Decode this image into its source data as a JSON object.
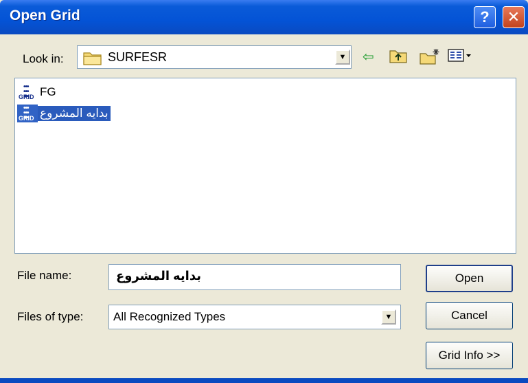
{
  "window": {
    "title": "Open Grid",
    "help_label": "?",
    "close_label": "✕",
    "colors": {
      "titlebar": "#0453d6",
      "selection": "#2a5bbc",
      "face": "#ece9d8"
    }
  },
  "look_in": {
    "label": "Look in:",
    "value": "SURFESR",
    "icon": "folder-icon",
    "arrow": "▼"
  },
  "toolbar": {
    "back_icon": "⇦",
    "up_icon": "⬆",
    "newfolder_icon": "✱",
    "views_icon": "▦▾"
  },
  "files": [
    {
      "name": "FG",
      "icon": "grid-file-icon",
      "icon_text": "GRID",
      "selected": false
    },
    {
      "name": "بدايه المشروع",
      "icon": "grid-file-icon",
      "icon_text": "GRID",
      "selected": true
    }
  ],
  "file_name": {
    "label": "File name:",
    "value": "بدايه المشروع"
  },
  "file_type": {
    "label": "Files of type:",
    "value": "All Recognized Types",
    "arrow": "▼"
  },
  "buttons": {
    "open": "Open",
    "cancel": "Cancel",
    "grid_info": "Grid Info >>"
  }
}
